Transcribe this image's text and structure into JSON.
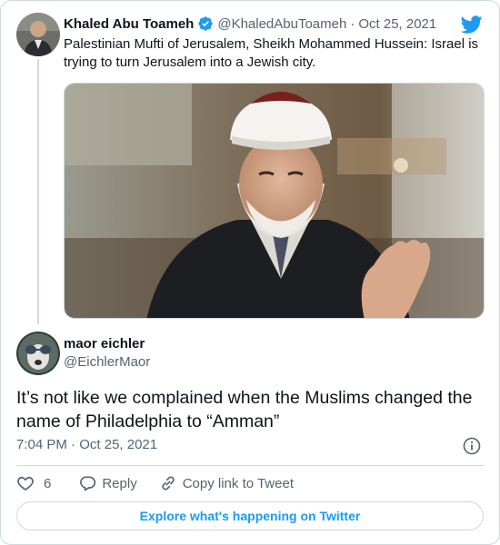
{
  "quoted_tweet": {
    "author_name": "Khaled Abu Toameh",
    "handle": "@KhaledAbuToameh",
    "separator": "·",
    "date": "Oct 25, 2021",
    "text": "Palestinian Mufti of Jerusalem, Sheikh Mohammed Hussein: Israel is trying to turn Jerusalem into a Jewish city.",
    "icons": [
      "verified-badge-icon",
      "twitter-bird-icon"
    ]
  },
  "tweet": {
    "author_name": "maor eichler",
    "handle": "@EichlerMaor",
    "text": "It’s not like we complained when the Muslims changed the name of Philadelphia to “Amman”",
    "time": "7:04 PM",
    "separator": "·",
    "date": "Oct 25, 2021"
  },
  "actions": {
    "like_count": "6",
    "reply_label": "Reply",
    "copy_link_label": "Copy link to Tweet"
  },
  "explore_label": "Explore what's happening on Twitter",
  "colors": {
    "accent": "#1d9bf0",
    "text": "#0f1419",
    "muted": "#536471",
    "border": "#cfd9de"
  }
}
